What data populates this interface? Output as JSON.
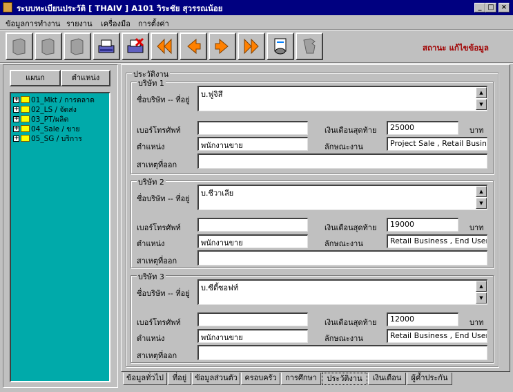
{
  "window": {
    "title": "ระบบทะเบียนประวัติ [ THAIV ]   A101   วิระชัย   สุวรรณน้อย",
    "min": "_",
    "max": "□",
    "close": "×"
  },
  "menu": [
    "ข้อมูลการทำงาน",
    "รายงาน",
    "เครื่องมือ",
    "การตั้งค่า"
  ],
  "toolbar": {
    "status": "สถานะ แก้ไขข้อมูล",
    "buttons": [
      "new-icon",
      "edit-icon",
      "delete-icon",
      "save-icon",
      "cancel-icon",
      "first-icon",
      "previous-icon",
      "next-icon",
      "last-icon",
      "search-icon",
      "exit-icon"
    ]
  },
  "left": {
    "tab_dept": "แผนก",
    "tab_position": "ตำแหน่ง",
    "tree": [
      "01_Mkt / การตลาด",
      "02_LS / จัดส่ง",
      "03_PT/ผลิต",
      "04_Sale / ขาย",
      "05_SG / บริการ"
    ]
  },
  "section_title": "ประวัติงาน",
  "labels": {
    "company": "ชื่อบริษัท -- ที่อยู่",
    "phone": "เบอร์โทรศัพท์",
    "last_salary": "เงินเดือนสุดท้าย",
    "baht": "บาท",
    "position": "ตำแหน่ง",
    "job_type": "ลักษณะงาน",
    "reason": "สาเหตุที่ออก"
  },
  "companies": [
    {
      "title": "บริษัท 1",
      "name": "บ.ฟูจิสึ",
      "phone": "",
      "salary": "25000",
      "position": "พนักงานขาย",
      "job_type": "Project Sale , Retail Business",
      "reason": ""
    },
    {
      "title": "บริษัท 2",
      "name": "บ.ชีวาเลีย",
      "phone": "",
      "salary": "19000",
      "position": "พนักงานขาย",
      "job_type": "Retail Business , End User",
      "reason": ""
    },
    {
      "title": "บริษัท 3",
      "name": "บ.ซีดี้ซอฟท์",
      "phone": "",
      "salary": "12000",
      "position": "พนักงานขาย",
      "job_type": "Retail Business , End User",
      "reason": ""
    }
  ],
  "tabs": [
    "ข้อมูลทั่วไป",
    "ที่อยู่",
    "ข้อมูลส่วนตัว",
    "ครอบครัว",
    "การศึกษา",
    "ประวัติงาน",
    "เงินเดือน",
    "ผู้ค้ำประกัน"
  ],
  "active_tab": "ประวัติงาน",
  "colors": {
    "title_bar": "#000080",
    "tree_bg": "#00aaaa",
    "status": "#a00000",
    "arrow": "#ff8000"
  }
}
